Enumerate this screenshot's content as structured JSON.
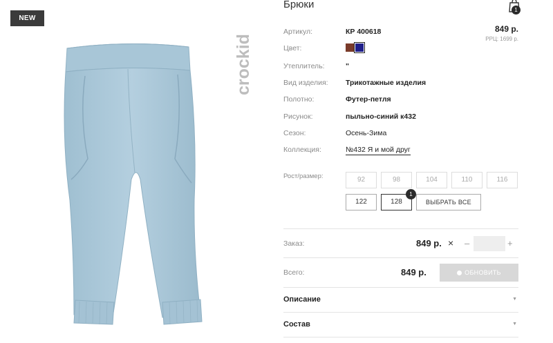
{
  "badge": "NEW",
  "brand": "crockid",
  "product": {
    "title": "Брюки",
    "bag_count": "1",
    "price": "849 р.",
    "rrp": "РРЦ: 1699 р."
  },
  "specs": [
    {
      "label": "Артикул:",
      "value": "КР 400618"
    },
    {
      "label": "Цвет:",
      "value": ""
    },
    {
      "label": "Утеплитель:",
      "value": "\""
    },
    {
      "label": "Вид изделия:",
      "value": "Трикотажные изделия"
    },
    {
      "label": "Полотно:",
      "value": "Футер-петля"
    },
    {
      "label": "Рисунок:",
      "value": "пыльно-синий к432"
    },
    {
      "label": "Сезон:",
      "value": "Осень-Зима"
    },
    {
      "label": "Коллекция:",
      "value": "№432 Я и мой друг"
    }
  ],
  "colors": [
    "#7a3b2a",
    "#1f1f8a"
  ],
  "sizes": {
    "label": "Рост/размер:",
    "row1": [
      "92",
      "98",
      "104",
      "110",
      "116"
    ],
    "row2": [
      "122",
      "128"
    ],
    "select_all": "ВЫБРАТЬ ВСЕ",
    "selected_count": "1"
  },
  "order": {
    "label": "Заказ:",
    "price": "849 р.",
    "times": "×",
    "minus": "–",
    "plus": "+",
    "qty": ""
  },
  "total": {
    "label": "Всего:",
    "price": "849 р.",
    "update": "ОБНОВИТЬ"
  },
  "sections": [
    {
      "title": "Описание"
    },
    {
      "title": "Состав"
    }
  ]
}
